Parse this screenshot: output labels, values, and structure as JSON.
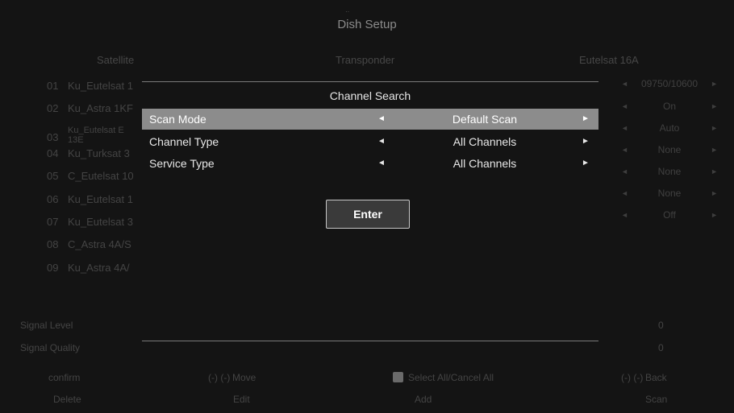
{
  "title": "Dish Setup",
  "title_mark": "··",
  "columns": {
    "satellite": "Satellite",
    "transponder": "Transponder",
    "current_satellite": "Eutelsat 16A"
  },
  "satellites": [
    {
      "num": "01",
      "name": "Ku_Eutelsat 1"
    },
    {
      "num": "02",
      "name": "Ku_Astra 1KF"
    },
    {
      "num": "03",
      "name": "Ku_Eutelsat E"
    },
    {
      "num": "04",
      "name": "Ku_Turksat 3"
    },
    {
      "num": "05",
      "name": "C_Eutelsat 10"
    },
    {
      "num": "06",
      "name": "Ku_Eutelsat 1"
    },
    {
      "num": "07",
      "name": "Ku_Eutelsat 3"
    },
    {
      "num": "08",
      "name": "C_Astra 4A/S"
    },
    {
      "num": "09",
      "name": "Ku_Astra 4A/"
    }
  ],
  "satellite_03_line2": "13E",
  "right_params": [
    {
      "value": "09750/10600",
      "left_arrow": "◄",
      "right_arrow": "►"
    },
    {
      "value": "On",
      "left_arrow": "◄",
      "right_arrow": "►"
    },
    {
      "value": "Auto",
      "left_arrow": "◄",
      "right_arrow": "►"
    },
    {
      "value": "None",
      "left_arrow": "◄",
      "right_arrow": "►"
    },
    {
      "value": "None",
      "left_arrow": "◄",
      "right_arrow": "►"
    },
    {
      "value": "None",
      "left_arrow": "◄",
      "right_arrow": "►"
    },
    {
      "value": "Off",
      "left_arrow": "◄",
      "right_arrow": "►"
    }
  ],
  "signal": {
    "level_label": "Signal Level",
    "level_value": "0",
    "quality_label": "Signal Quality",
    "quality_value": "0"
  },
  "footer": {
    "confirm": "confirm",
    "move": "Move",
    "move_keys": "(-) (-)",
    "select_all": "Select All/Cancel All",
    "back": "Back",
    "back_key": "(-) (-)",
    "delete": "Delete",
    "edit": "Edit",
    "add": "Add",
    "scan": "Scan"
  },
  "dialog": {
    "title": "Channel Search",
    "options": [
      {
        "label": "Scan Mode",
        "value": "Default Scan",
        "left_arrow": "◄",
        "right_arrow": "►"
      },
      {
        "label": "Channel Type",
        "value": "All Channels",
        "left_arrow": "◄",
        "right_arrow": "►"
      },
      {
        "label": "Service Type",
        "value": "All Channels",
        "left_arrow": "◄",
        "right_arrow": "►"
      }
    ],
    "enter_label": "Enter"
  }
}
